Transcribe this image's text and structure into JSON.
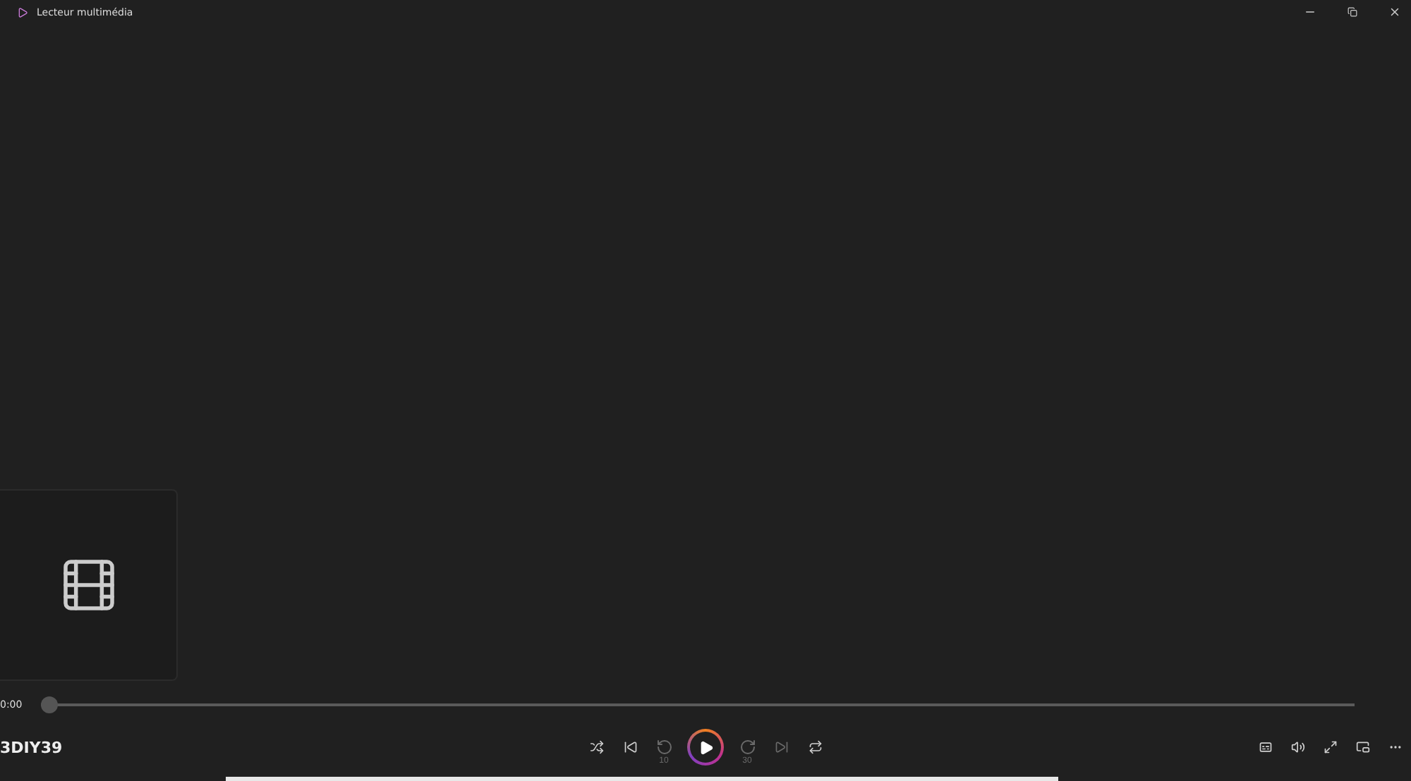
{
  "window": {
    "title": "Lecteur multimédia"
  },
  "thumbnail": {
    "kind": "video"
  },
  "seek": {
    "elapsed": "0:00",
    "level": 0
  },
  "now_playing": {
    "title": "3DIY39"
  },
  "transport": [
    {
      "kind": "shuffle",
      "disabled": false
    },
    {
      "kind": "previous",
      "disabled": false
    },
    {
      "kind": "back",
      "label": "10",
      "disabled": true
    },
    {
      "kind": "play",
      "disabled": false
    },
    {
      "kind": "forward",
      "label": "30",
      "disabled": true
    },
    {
      "kind": "next",
      "disabled": true
    },
    {
      "kind": "repeat",
      "disabled": false
    }
  ],
  "right_controls": [
    {
      "kind": "captions"
    },
    {
      "kind": "volume"
    },
    {
      "kind": "fullscreen"
    },
    {
      "kind": "miniplayer"
    },
    {
      "kind": "more"
    }
  ]
}
